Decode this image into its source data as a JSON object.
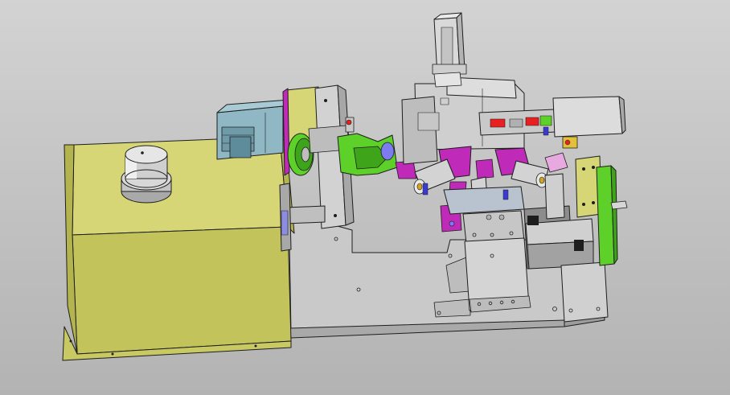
{
  "scene": {
    "subject": "cad-assembly-isometric",
    "colors": {
      "background_top": "#d3d3d3",
      "background_bottom": "#b3b3b3",
      "base_plate": "#c9c9c9",
      "enclosure": "#cfcf6e",
      "enclosure_front": "#c3c35c",
      "motor": "#8fb7c4",
      "steel": "#b8b8b8",
      "green_parts": "#5ed02a",
      "magenta_parts": "#c02ab8",
      "red_parts": "#e82020",
      "outline": "#1e1e1e"
    }
  }
}
